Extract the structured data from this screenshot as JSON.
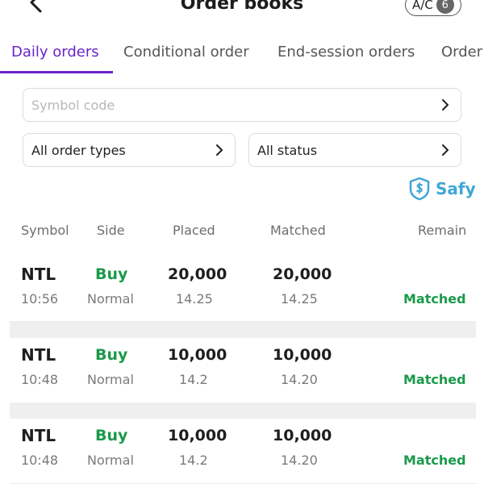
{
  "header": {
    "title": "Order books",
    "account_label": "A/C",
    "account_count": "6"
  },
  "tabs": [
    {
      "label": "Daily orders",
      "active": true
    },
    {
      "label": "Conditional order",
      "active": false
    },
    {
      "label": "End-session orders",
      "active": false
    },
    {
      "label": "Order",
      "active": false
    }
  ],
  "filters": {
    "symbol_placeholder": "Symbol code",
    "order_type": "All order types",
    "status": "All status"
  },
  "brand": {
    "name": "Safy",
    "color": "#3fa7d6"
  },
  "columns": {
    "symbol": "Symbol",
    "side": "Side",
    "placed": "Placed",
    "matched": "Matched",
    "remain": "Remain"
  },
  "orders": [
    {
      "symbol": "NTL",
      "time": "10:56",
      "side": "Buy",
      "type": "Normal",
      "placed_qty": "20,000",
      "placed_price": "14.25",
      "matched_qty": "20,000",
      "matched_price": "14.25",
      "status": "Matched"
    },
    {
      "symbol": "NTL",
      "time": "10:48",
      "side": "Buy",
      "type": "Normal",
      "placed_qty": "10,000",
      "placed_price": "14.2",
      "matched_qty": "10,000",
      "matched_price": "14.20",
      "status": "Matched"
    },
    {
      "symbol": "NTL",
      "time": "10:48",
      "side": "Buy",
      "type": "Normal",
      "placed_qty": "10,000",
      "placed_price": "14.2",
      "matched_qty": "10,000",
      "matched_price": "14.20",
      "status": "Matched"
    }
  ],
  "colors": {
    "accent": "#6a24c9",
    "buy": "#1a9a4a",
    "matched": "#1a9a4a"
  }
}
